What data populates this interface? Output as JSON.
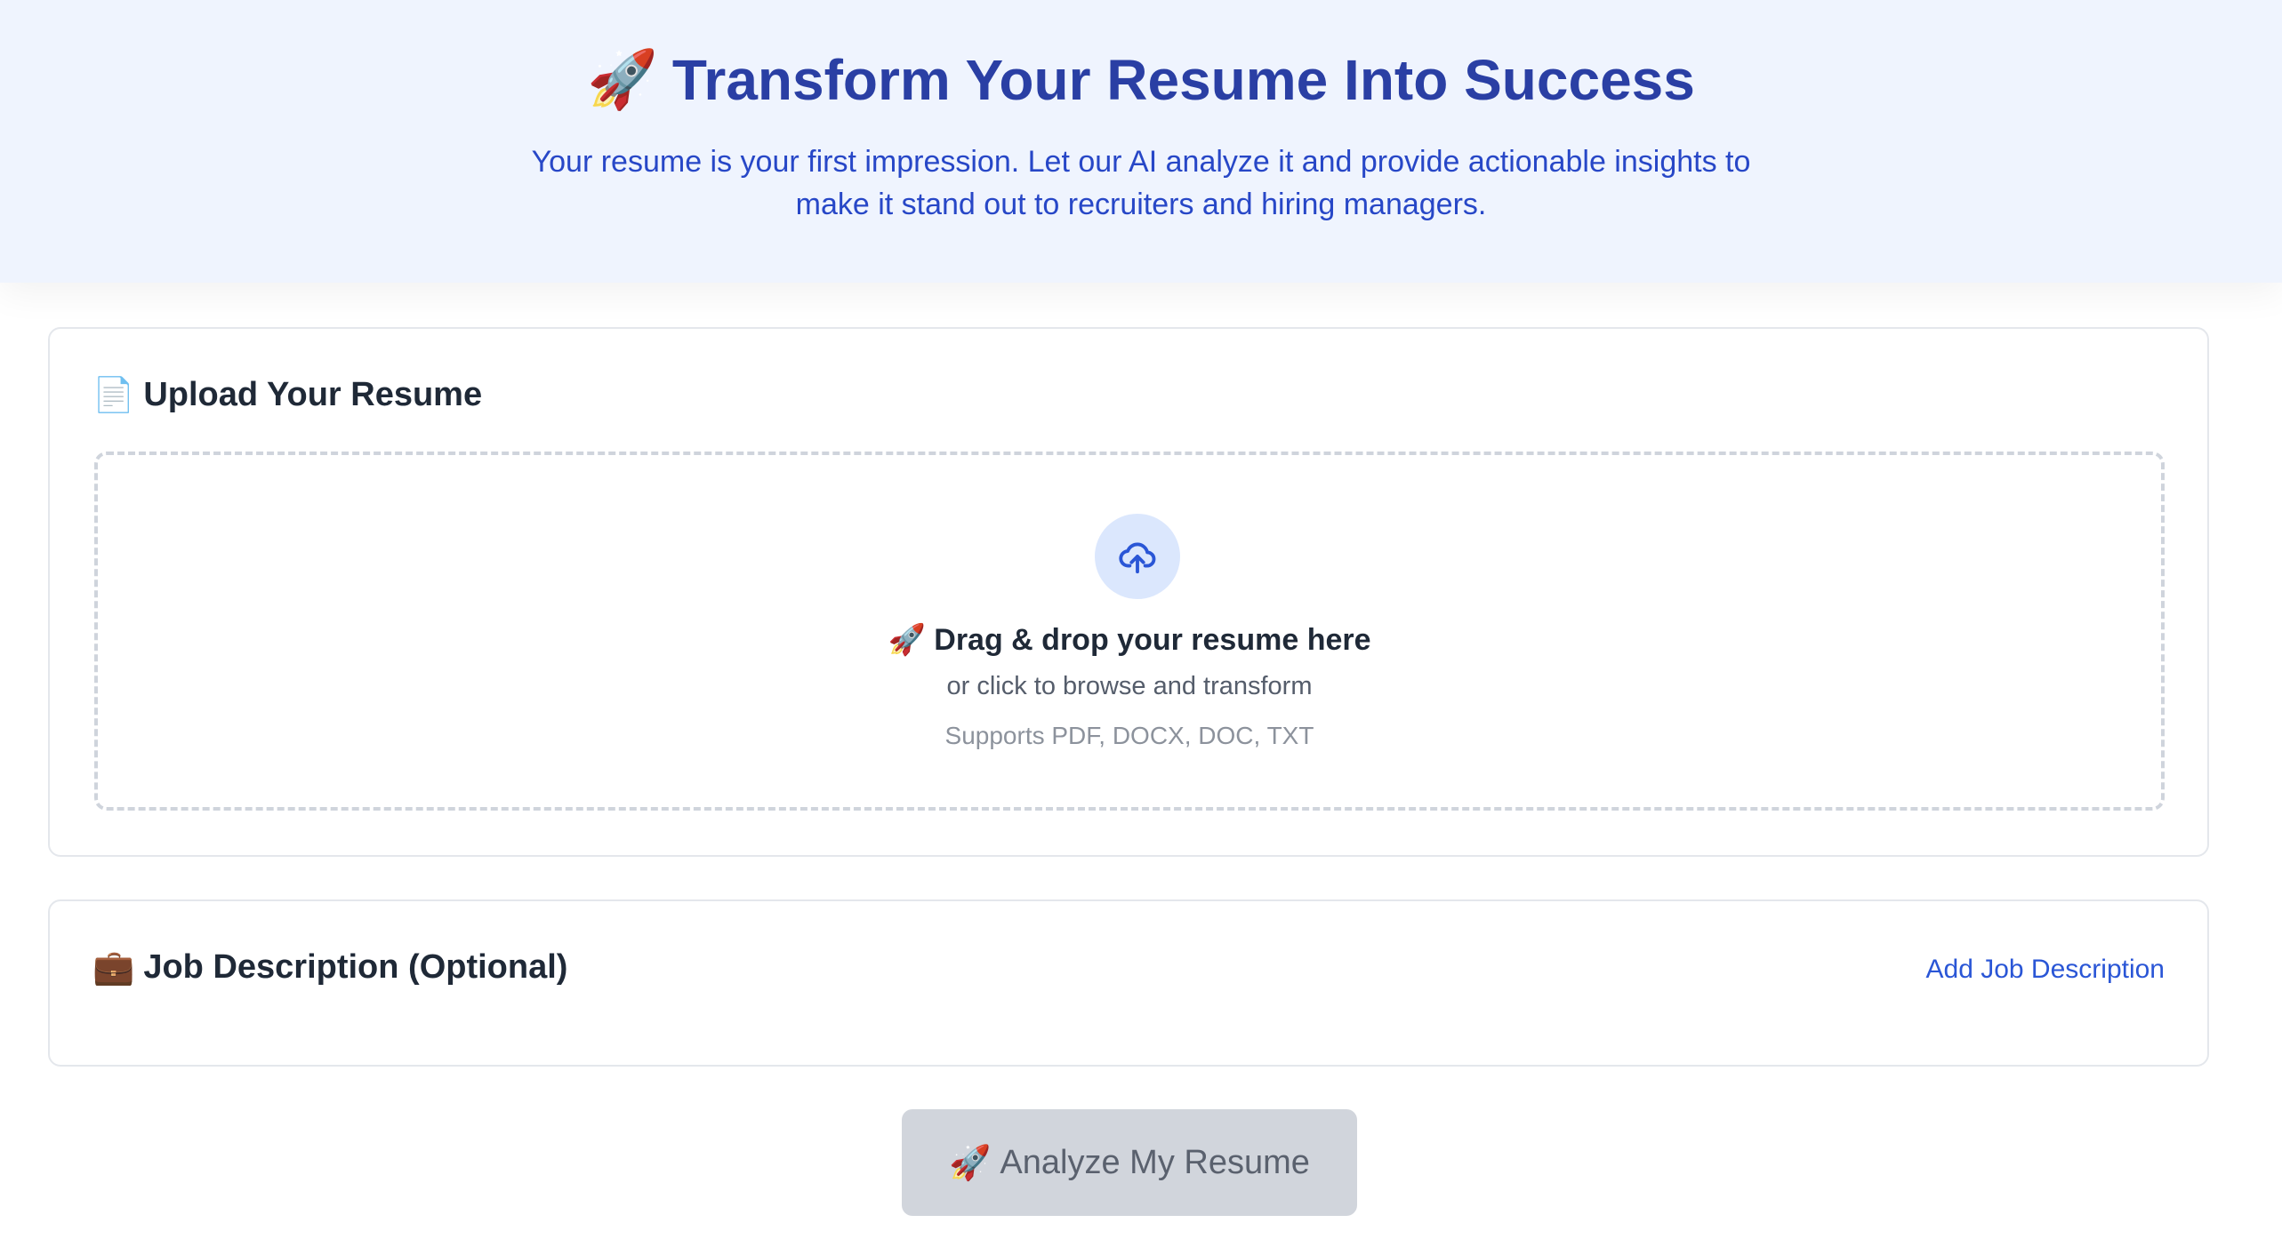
{
  "hero": {
    "title_icon": "🚀",
    "title": "Transform Your Resume Into Success",
    "subtitle": "Your resume is your first impression. Let our AI analyze it and provide actionable insights to make it stand out to recruiters and hiring managers."
  },
  "upload_card": {
    "icon": "📄",
    "title": "Upload Your Resume",
    "dropzone": {
      "upload_icon": "cloud-upload-icon",
      "main_icon": "🚀",
      "main_text": "Drag & drop your resume here",
      "sub_text": "or click to browse and transform",
      "formats": "Supports PDF, DOCX, DOC, TXT"
    }
  },
  "job_card": {
    "icon": "💼",
    "title": "Job Description (Optional)",
    "add_link": "Add Job Description"
  },
  "analyze_button": {
    "icon": "🚀",
    "label": "Analyze My Resume",
    "disabled": true
  },
  "colors": {
    "hero_bg": "#eff4fe",
    "title": "#2a3fa4",
    "subtitle": "#2747c7",
    "link": "#2a56d6",
    "upload_circle": "#dbe7fd",
    "button_disabled_bg": "#d1d5dc"
  }
}
